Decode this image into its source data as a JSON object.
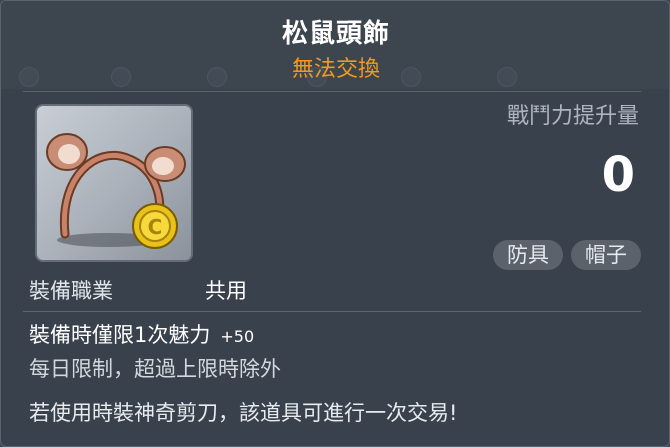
{
  "item": {
    "name": "松鼠頭飾",
    "trade_status": "無法交換",
    "icon": "squirrel-headband-icon",
    "power_label": "戰鬥力提升量",
    "power_value": "0",
    "tags": [
      "防具",
      "帽子"
    ],
    "job_label": "裝備職業",
    "job_value": "共用"
  },
  "details": {
    "equip_effect": "裝備時僅限1次魅力",
    "equip_effect_value": "+50",
    "daily_limit": "每日限制，超過上限時除外",
    "scissor_note": "若使用時裝神奇剪刀，該道具可進行一次交易!"
  },
  "colors": {
    "background": "#39414c",
    "title": "#ffffff",
    "trade_status": "#f39a1e",
    "tag_bg": "#5b626c"
  }
}
